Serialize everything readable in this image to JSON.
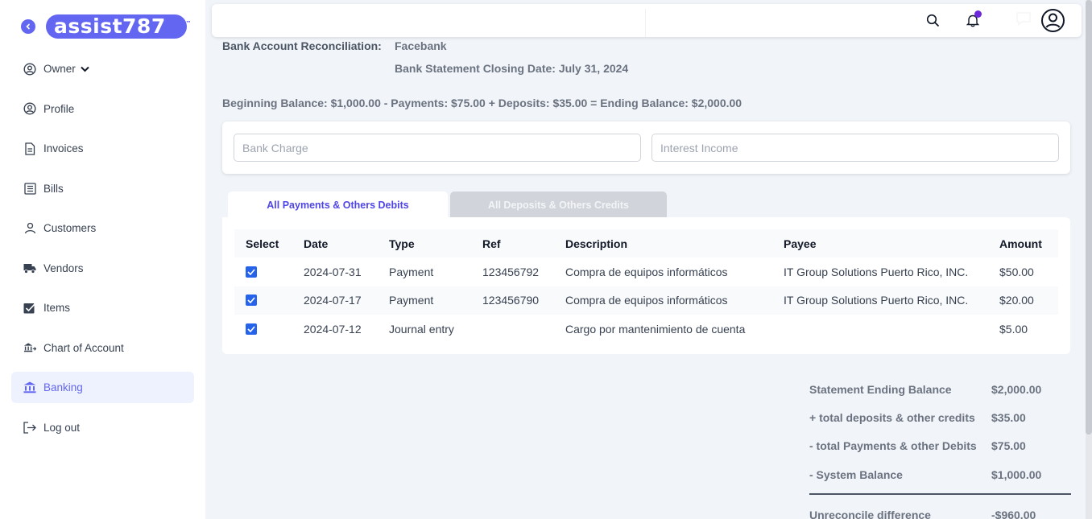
{
  "brand": {
    "name": "assist787"
  },
  "sidebar": {
    "items": [
      {
        "label": "Owner"
      },
      {
        "label": "Profile"
      },
      {
        "label": "Invoices"
      },
      {
        "label": "Bills"
      },
      {
        "label": "Customers"
      },
      {
        "label": "Vendors"
      },
      {
        "label": "Items"
      },
      {
        "label": "Chart of Account"
      },
      {
        "label": "Banking"
      },
      {
        "label": "Log out"
      }
    ]
  },
  "header": {
    "reconciliation_label": "Bank Account Reconciliation:",
    "bank_name": "Facebank",
    "closing_date": "Bank Statement Closing Date: July 31, 2024",
    "balance_formula": "Beginning Balance: $1,000.00 - Payments: $75.00 + Deposits: $35.00 = Ending Balance: $2,000.00"
  },
  "filters": {
    "bank_charge_placeholder": "Bank Charge",
    "interest_income_placeholder": "Interest Income"
  },
  "tabs": [
    {
      "label": "All Payments & Others Debits"
    },
    {
      "label": "All Deposits & Others Credits"
    }
  ],
  "table": {
    "columns": [
      "Select",
      "Date",
      "Type",
      "Ref",
      "Description",
      "Payee",
      "Amount"
    ],
    "rows": [
      {
        "date": "2024-07-31",
        "type": "Payment",
        "ref": "123456792",
        "description": "Compra de equipos informáticos",
        "payee": "IT Group Solutions Puerto Rico, INC.",
        "amount": "$50.00",
        "checked": true
      },
      {
        "date": "2024-07-17",
        "type": "Payment",
        "ref": "123456790",
        "description": "Compra de equipos informáticos",
        "payee": "IT Group Solutions Puerto Rico, INC.",
        "amount": "$20.00",
        "checked": true
      },
      {
        "date": "2024-07-12",
        "type": "Journal entry",
        "ref": "",
        "description": "Cargo por mantenimiento de cuenta",
        "payee": "",
        "amount": "$5.00",
        "checked": true
      }
    ]
  },
  "summary": [
    {
      "label": "Statement Ending Balance",
      "value": "$2,000.00"
    },
    {
      "label": "+ total deposits & other credits",
      "value": "$35.00"
    },
    {
      "label": "- total Payments & other Debits",
      "value": "$75.00"
    },
    {
      "label": "- System Balance",
      "value": "$1,000.00"
    },
    {
      "label": "Unreconcile difference",
      "value": "-$960.00"
    }
  ],
  "colors": {
    "accent": "#6366f1",
    "active_bg": "#eef2ff",
    "checkbox": "#2563eb",
    "notification": "#6d28d9"
  }
}
